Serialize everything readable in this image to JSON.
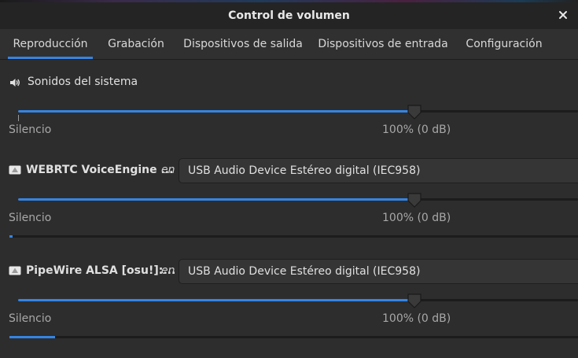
{
  "window": {
    "title": "Control de volumen",
    "close_icon": "close-icon"
  },
  "tabs": [
    {
      "label": "Reproducción",
      "active": true
    },
    {
      "label": "Grabación",
      "active": false
    },
    {
      "label": "Dispositivos de salida",
      "active": false
    },
    {
      "label": "Dispositivos de entrada",
      "active": false
    },
    {
      "label": "Configuración",
      "active": false
    }
  ],
  "streams": [
    {
      "icon": "speaker-icon",
      "name": "Sonidos del sistema",
      "volume_percent": 70.8,
      "silence_label": "Silencio",
      "hundred_label": "100% (0 dB)"
    },
    {
      "icon": "app-icon",
      "name": "WEBRTC VoiceEngine ...",
      "en_label": "en",
      "device": "USB Audio Device Estéreo digital (IEC958)",
      "volume_percent": 70.8,
      "silence_label": "Silencio",
      "hundred_label": "100% (0 dB)",
      "level_percent": 0.5
    },
    {
      "icon": "app-icon",
      "name": "PipeWire ALSA [osu!]:...",
      "en_label": "en",
      "device": "USB Audio Device Estéreo digital (IEC958)",
      "volume_percent": 70.8,
      "silence_label": "Silencio",
      "hundred_label": "100% (0 dB)",
      "level_percent": 8
    }
  ],
  "colors": {
    "accent": "#3584e4",
    "background": "#2d2d2d",
    "titlebar": "#242424"
  }
}
